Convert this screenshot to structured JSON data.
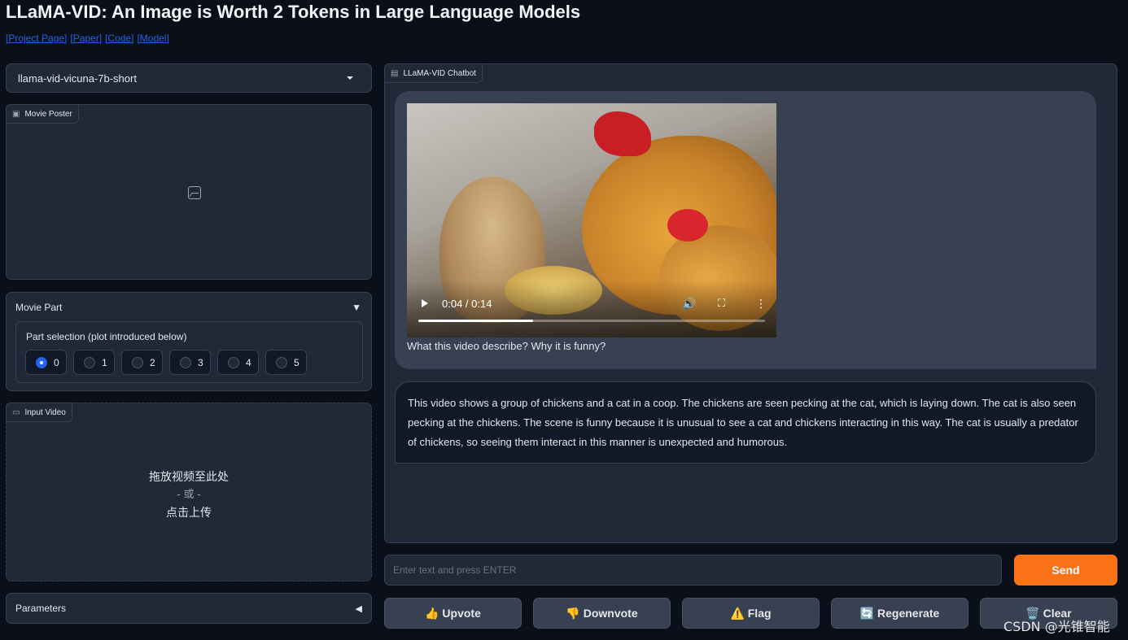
{
  "page": {
    "title": "LLaMA-VID: An Image is Worth 2 Tokens in Large Language Models",
    "links": [
      "[Project Page]",
      "[Paper]",
      "[Code]",
      "[Model]"
    ]
  },
  "model_select": {
    "value": "llama-vid-vicuna-7b-short"
  },
  "movie_poster": {
    "label": "Movie Poster"
  },
  "movie_part": {
    "label": "Movie Part",
    "collapse_icon": "▼",
    "part_selection_label": "Part selection (plot introduced below)",
    "options": [
      "0",
      "1",
      "2",
      "3",
      "4",
      "5"
    ],
    "selected": "0"
  },
  "input_video": {
    "label": "Input Video",
    "drop_text": "拖放视频至此处",
    "or_text": "- 或 -",
    "click_text": "点击上传"
  },
  "parameters": {
    "label": "Parameters",
    "expand_icon": "◀"
  },
  "chatbot": {
    "label": "LLaMA-VID Chatbot",
    "video": {
      "time": "0:04 / 0:14",
      "progress": 0.33
    },
    "user_message": "What this video describe? Why it is funny?",
    "bot_message": "This video shows a group of chickens and a cat in a coop. The chickens are seen pecking at the cat, which is laying down. The cat is also seen pecking at the chickens. The scene is funny because it is unusual to see a cat and chickens interacting in this way. The cat is usually a predator of chickens, so seeing them interact in this manner is unexpected and humorous."
  },
  "input": {
    "placeholder": "Enter text and press ENTER"
  },
  "buttons": {
    "send": "Send",
    "upvote": "👍 Upvote",
    "downvote": "👎 Downvote",
    "flag": "⚠️ Flag",
    "regenerate": "🔄 Regenerate",
    "clear": "🗑️ Clear"
  },
  "watermark": "CSDN @光锥智能"
}
